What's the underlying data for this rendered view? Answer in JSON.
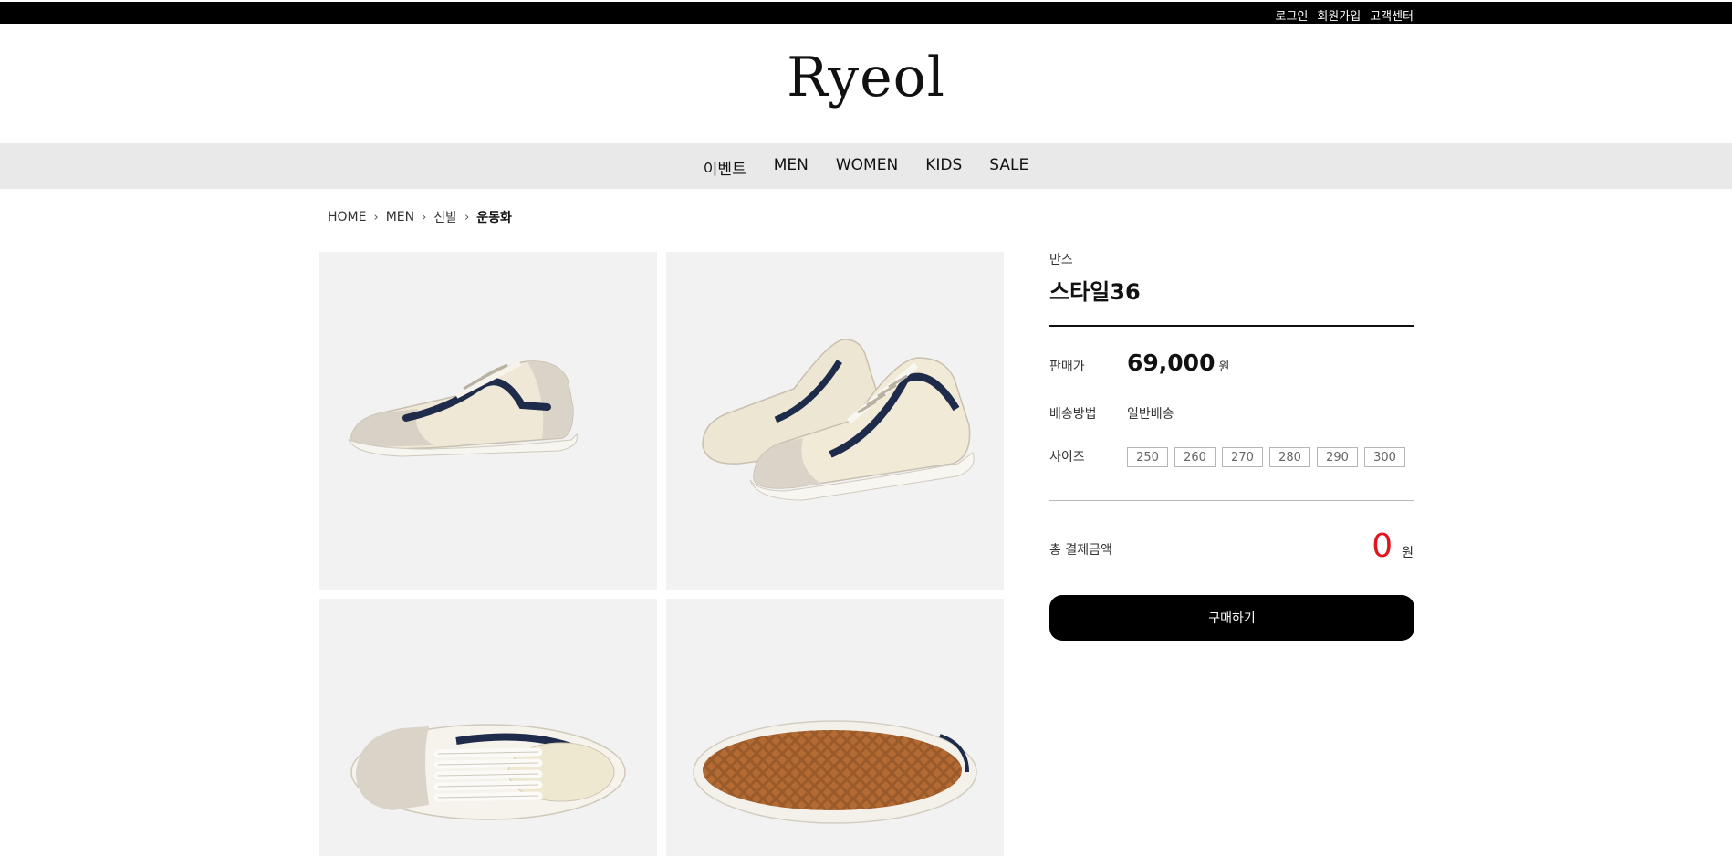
{
  "topbar": {
    "links": [
      "로그인",
      "회원가입",
      "고객센터"
    ]
  },
  "logo": "Ryeol",
  "nav": {
    "items": [
      "이벤트",
      "MEN",
      "WOMEN",
      "KIDS",
      "SALE"
    ]
  },
  "breadcrumb": [
    "HOME",
    "MEN",
    "신발",
    "운동화"
  ],
  "product": {
    "brand": "반스",
    "name": "스타일36",
    "price_label": "판매가",
    "price": "69,000",
    "currency": "원",
    "shipping_label": "배송방법",
    "shipping": "일반배송",
    "size_label": "사이즈",
    "sizes": [
      "250",
      "260",
      "270",
      "280",
      "290",
      "300"
    ]
  },
  "total": {
    "label": "총 결제금액",
    "value": "0",
    "unit": "원"
  },
  "buy_label": "구매하기",
  "colors": {
    "accent_red": "#e1141f",
    "topbar": "#000000",
    "nav_bg": "#e9e9e9",
    "tile_bg": "#f2f2f2"
  }
}
